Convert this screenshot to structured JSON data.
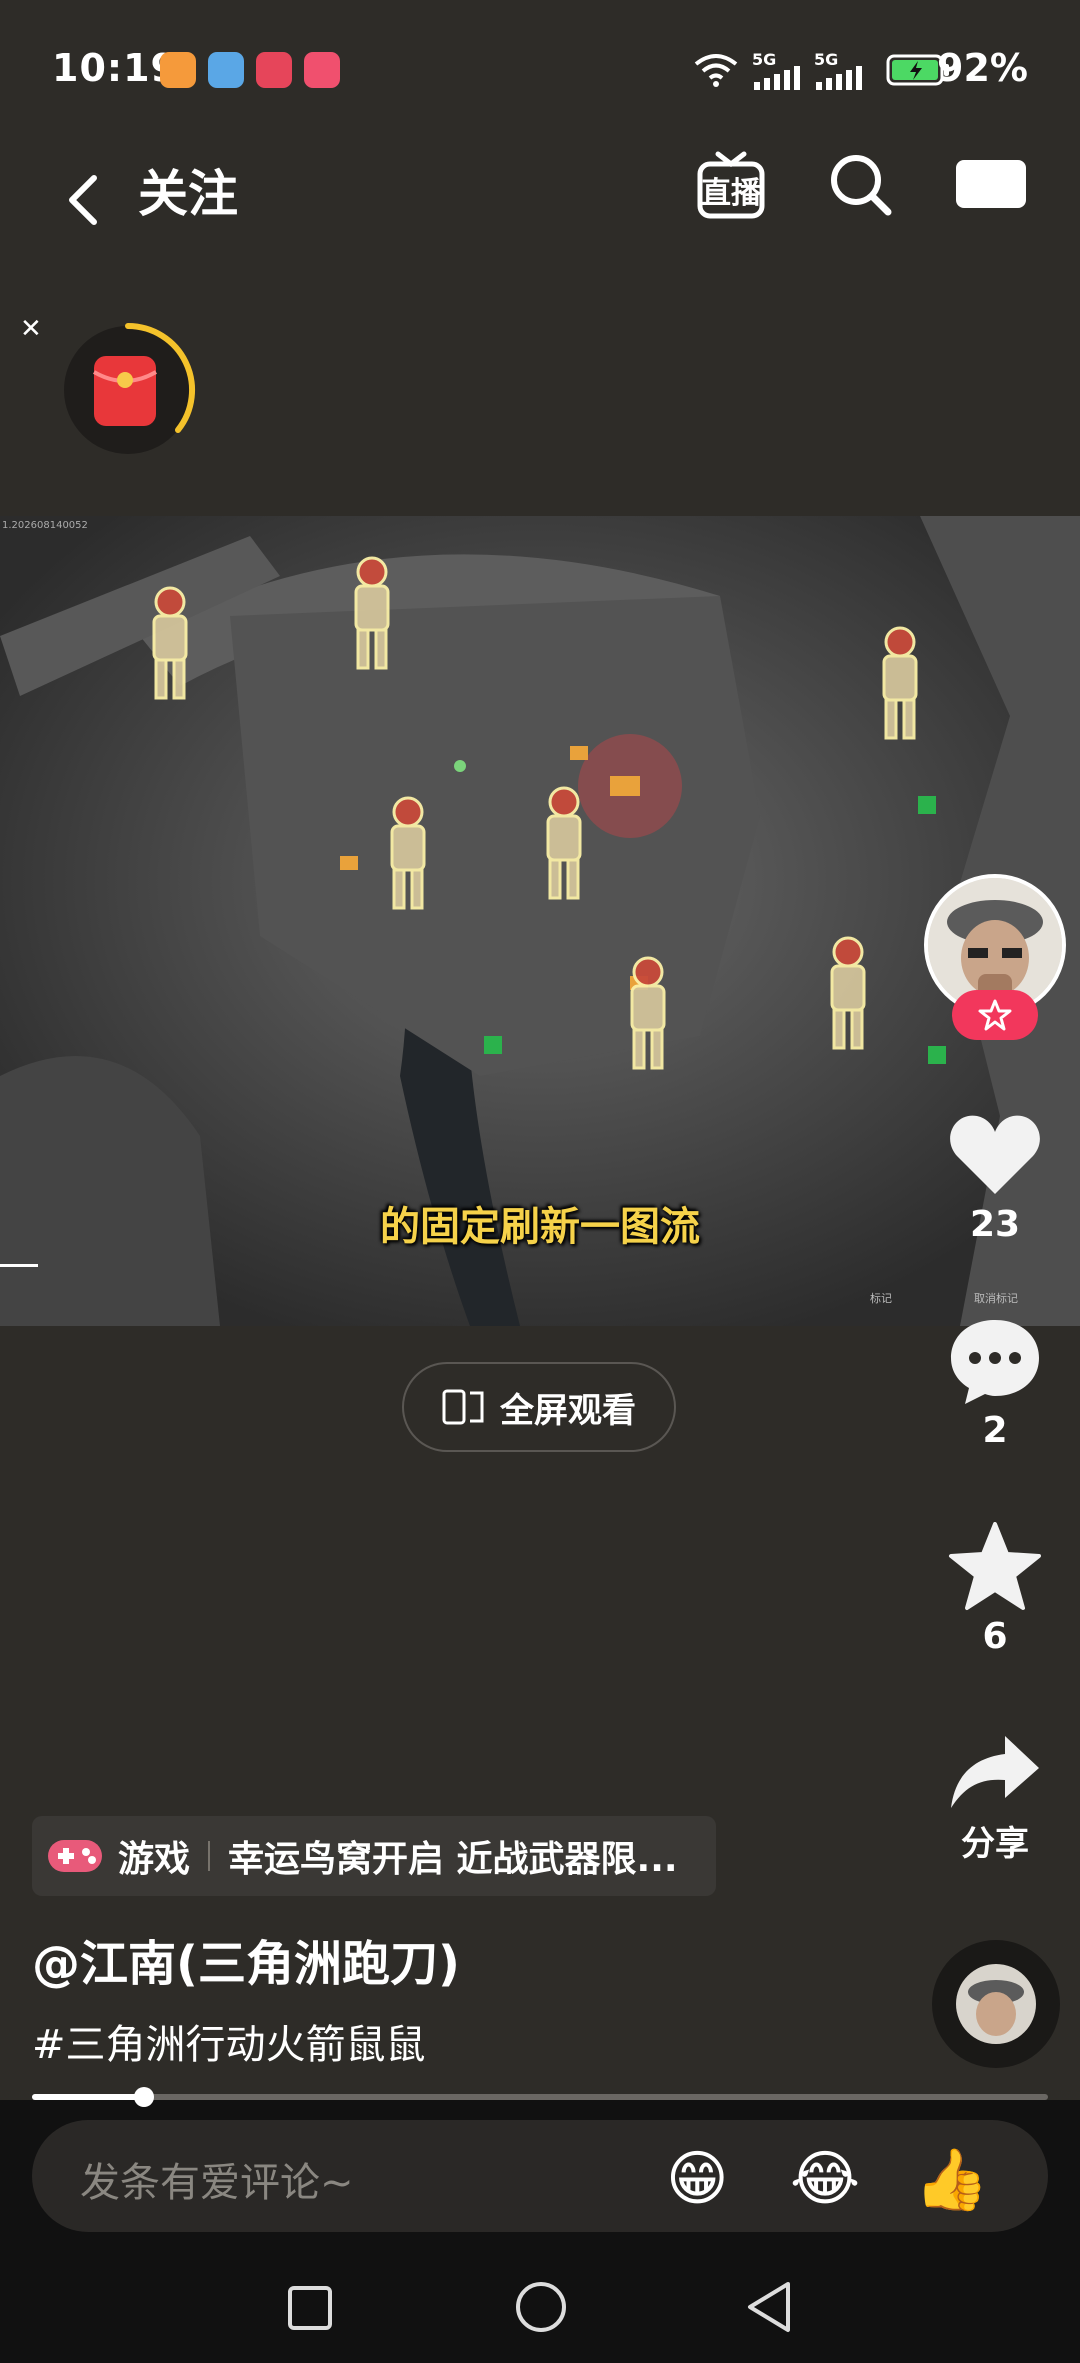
{
  "status_bar": {
    "time": "10:19",
    "network_1": "5G",
    "network_2": "5G",
    "battery": "92%"
  },
  "header": {
    "back_icon": "chevron-left-icon",
    "title": "关注",
    "live_label": "直播",
    "search_icon": "search-icon",
    "menu_icon": "video-card-icon"
  },
  "video": {
    "watermark": "1.202608140052",
    "subtitle": "的固定刷新一图流",
    "map_labels": [
      "标记",
      "取消标记"
    ]
  },
  "fullscreen_button": {
    "label": "全屏观看"
  },
  "actions": {
    "likes": "23",
    "comments": "2",
    "favorites": "6",
    "share_label": "分享"
  },
  "tag_bar": {
    "category": "游戏",
    "text": "幸运鸟窝开启 近战武器限..."
  },
  "author": "@江南(三角洲跑刀)",
  "hashtag": "#三角洲行动火箭鼠鼠",
  "progress": 0.11,
  "comment_bar": {
    "placeholder": "发条有爱评论~",
    "emoji_1": "😁",
    "emoji_2": "😂",
    "emoji_3": "👍"
  }
}
